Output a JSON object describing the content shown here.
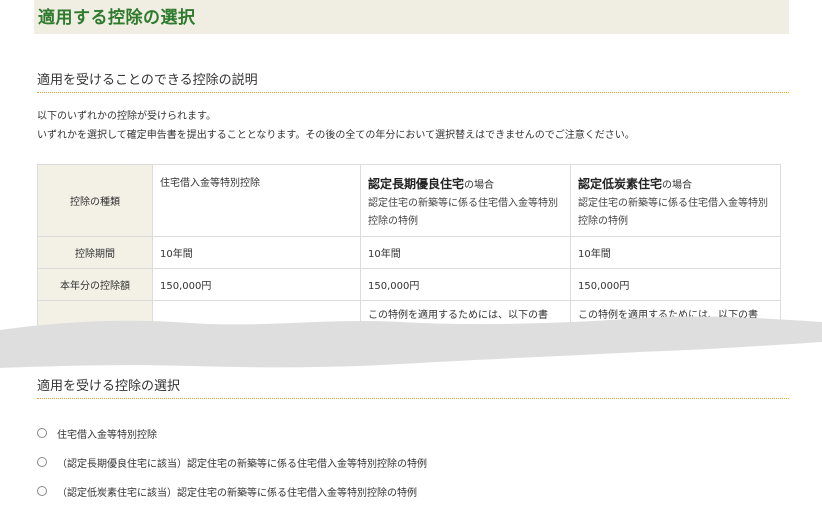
{
  "page_title": "適用する控除の選択",
  "explanation_section": {
    "heading": "適用を受けることのできる控除の説明",
    "intro_line1": "以下のいずれかの控除が受けられます。",
    "intro_line2": "いずれかを選択して確定申告書を提出することとなります。その後の全ての年分において選択替えはできませんのでご注意ください。"
  },
  "table": {
    "row_type_label": "控除の種類",
    "row_period_label": "控除期間",
    "row_amount_label": "本年分の控除額",
    "columns": [
      {
        "name": "住宅借入金等特別控除",
        "period": "10年間",
        "amount": "150,000円"
      },
      {
        "name_strong": "認定長期優良住宅",
        "name_suffix": "の場合",
        "description": "認定住宅の新築等に係る住宅借入金等特別控除の特例",
        "period": "10年間",
        "amount": "150,000円",
        "note": "この特例を適用するためには、以下の書"
      },
      {
        "name_strong": "認定低炭素住宅",
        "name_suffix": "の場合",
        "description": "認定住宅の新築等に係る住宅借入金等特別控除の特例",
        "period": "10年間",
        "amount": "150,000円",
        "note": "この特例を適用するためには、以下の書"
      }
    ]
  },
  "selection_section": {
    "heading": "適用を受ける控除の選択",
    "options": [
      {
        "label": "住宅借入金等特別控除"
      },
      {
        "label": "（認定長期優良住宅に該当）認定住宅の新築等に係る住宅借入金等特別控除の特例"
      },
      {
        "label": "（認定低炭素住宅に該当）認定住宅の新築等に係る住宅借入金等特別控除の特例"
      }
    ]
  },
  "colors": {
    "title_green": "#2f7b2e",
    "title_bar_bg": "#f0ede2",
    "header_cell_bg": "#f3f0e6",
    "dotted_rule": "#e0a62e",
    "tear_gray": "#dedede"
  }
}
